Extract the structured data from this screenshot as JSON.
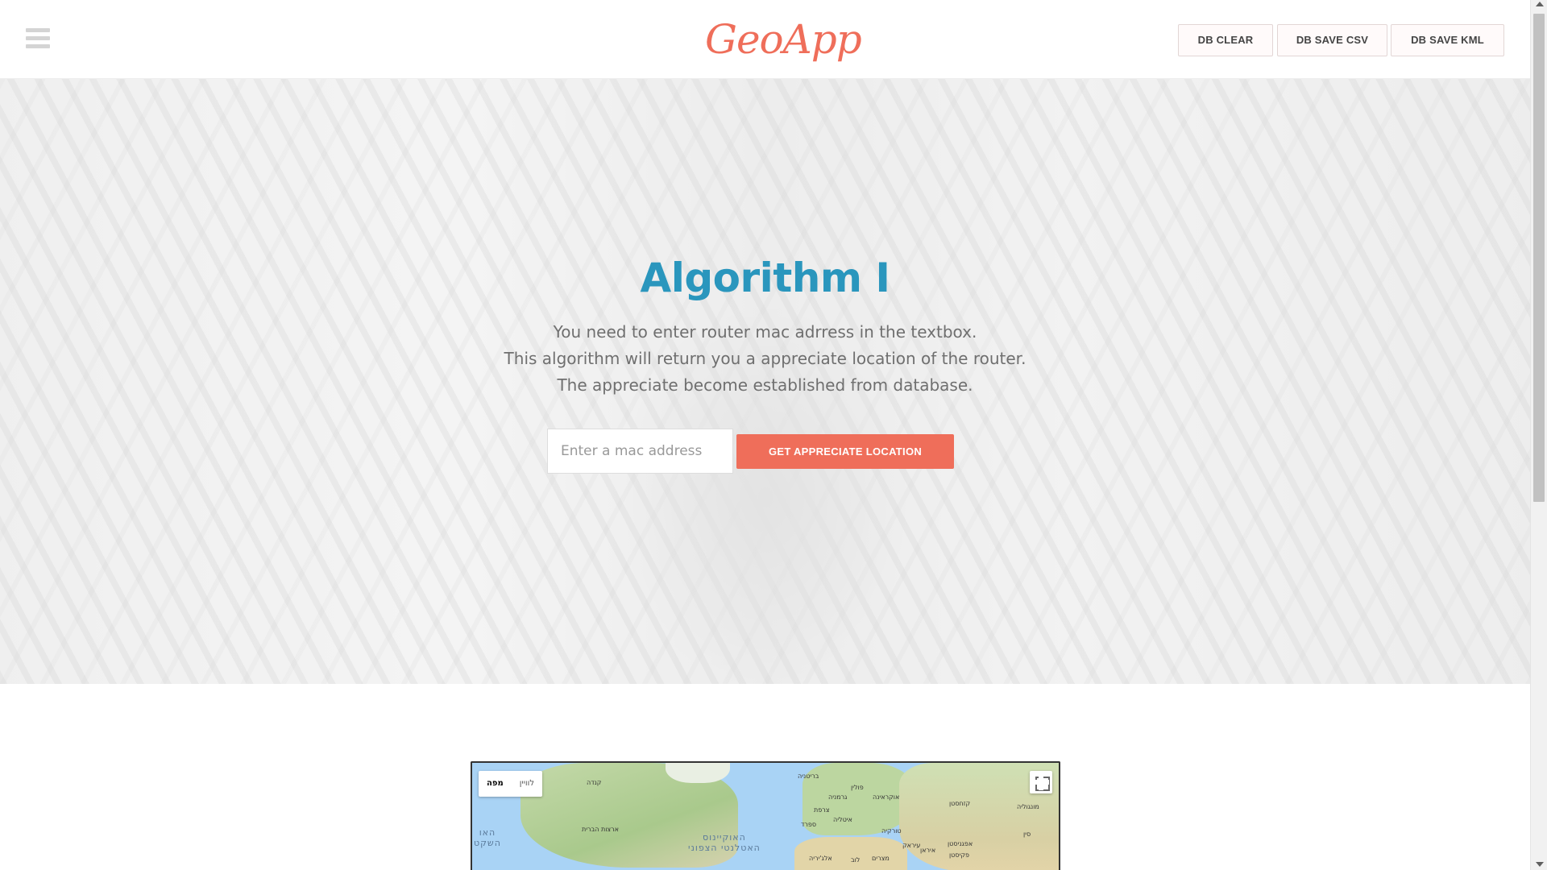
{
  "header": {
    "logo": "GeoApp",
    "buttons": {
      "clear": "DB CLEAR",
      "save_csv": "DB SAVE CSV",
      "save_kml": "DB SAVE KML"
    }
  },
  "hero": {
    "title": "Algorithm I",
    "lines": [
      "You need to enter router mac adrress in the textbox.",
      "This algorithm will return you a appreciate location of the router.",
      "The appreciate become established from database."
    ],
    "input_placeholder": "Enter a mac address",
    "submit_label": "GET APPRECIATE LOCATION"
  },
  "map": {
    "type_controls": [
      "מפה",
      "לוויין"
    ],
    "labels": {
      "canada": "קנדה",
      "usa": "ארצות הברית",
      "pacific": "האו\nהשקט",
      "atlantic": "האוקיינוס\nהאטלנטי הצפוני",
      "uk": "בריטניה",
      "poland": "פולין",
      "germany": "גרמניה",
      "france": "צרפת",
      "ukraine": "אוקראינה",
      "italy": "איטליה",
      "spain": "ספרד",
      "turkey": "טורקיה",
      "kazakhstan": "קזחסטן",
      "mongolia": "מונגוליה",
      "china": "סין",
      "iraq": "עיראק",
      "iran": "איראן",
      "afghanistan": "אפגניסטן",
      "pakistan": "פקיסטן",
      "algeria": "אלג'יריה",
      "libya": "לוב",
      "egypt": "מצרים"
    }
  },
  "colors": {
    "accent": "#ef6e5a",
    "title": "#2a96bd"
  }
}
